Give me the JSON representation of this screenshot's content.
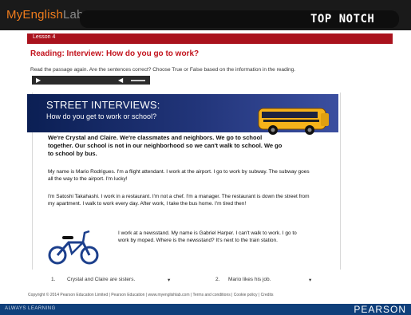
{
  "header": {
    "brand_main": "MyEnglish",
    "brand_dim": "Lab",
    "product": "TOP NOTCH"
  },
  "lesson": {
    "label": "Lesson 4"
  },
  "activity": {
    "title": "Reading: Interview: How do you go to work?",
    "instructions": "Read the passage again. Are the sentences correct? Choose True or False based on the information in the reading."
  },
  "player": {
    "play_icon": "▶",
    "volume_icon": "◀"
  },
  "reading": {
    "banner_title": "STREET INTERVIEWS:",
    "banner_subtitle": "How do you get to work or school?",
    "para1": "We're Crystal and Claire. We're classmates and neighbors. We go to school together. Our school is not in our neighborhood so we can't walk to school. We go to school by bus.",
    "para2": "My name is Mario Rodrigues. I'm a flight attendant. I work at the airport. I go to work by subway. The subway goes all the way to the airport. I'm lucky!",
    "para3": "I'm Satoshi Takahashi. I work in a restaurant. I'm not a chef. I'm a manager. The restaurant is down the street from my apartment. I walk to work every day. After work, I take the bus home. I'm tired then!",
    "para4": "I work at a newsstand. My name is Gabriel Harper. I can't walk to work. I go to work by moped. Where is the newsstand? It's next to the train station."
  },
  "questions": [
    {
      "number": "1.",
      "text": "Crystal and Claire are sisters.",
      "arrow": "▾"
    },
    {
      "number": "2.",
      "text": "Mario likes his job.",
      "arrow": "▾"
    }
  ],
  "footer": {
    "text": "Copyright © 2014 Pearson Education Limited | Pearson Education | www.myenglishlab.com | Terms and conditions | Cookie policy | Credits"
  },
  "bottom": {
    "left": "ALWAYS LEARNING",
    "right": "PEARSON"
  },
  "colors": {
    "accent_red": "#c2121c",
    "lesson_bar": "#a9121d",
    "banner_navy": "#0b1f54",
    "pearson_blue": "#0f3f7a"
  }
}
